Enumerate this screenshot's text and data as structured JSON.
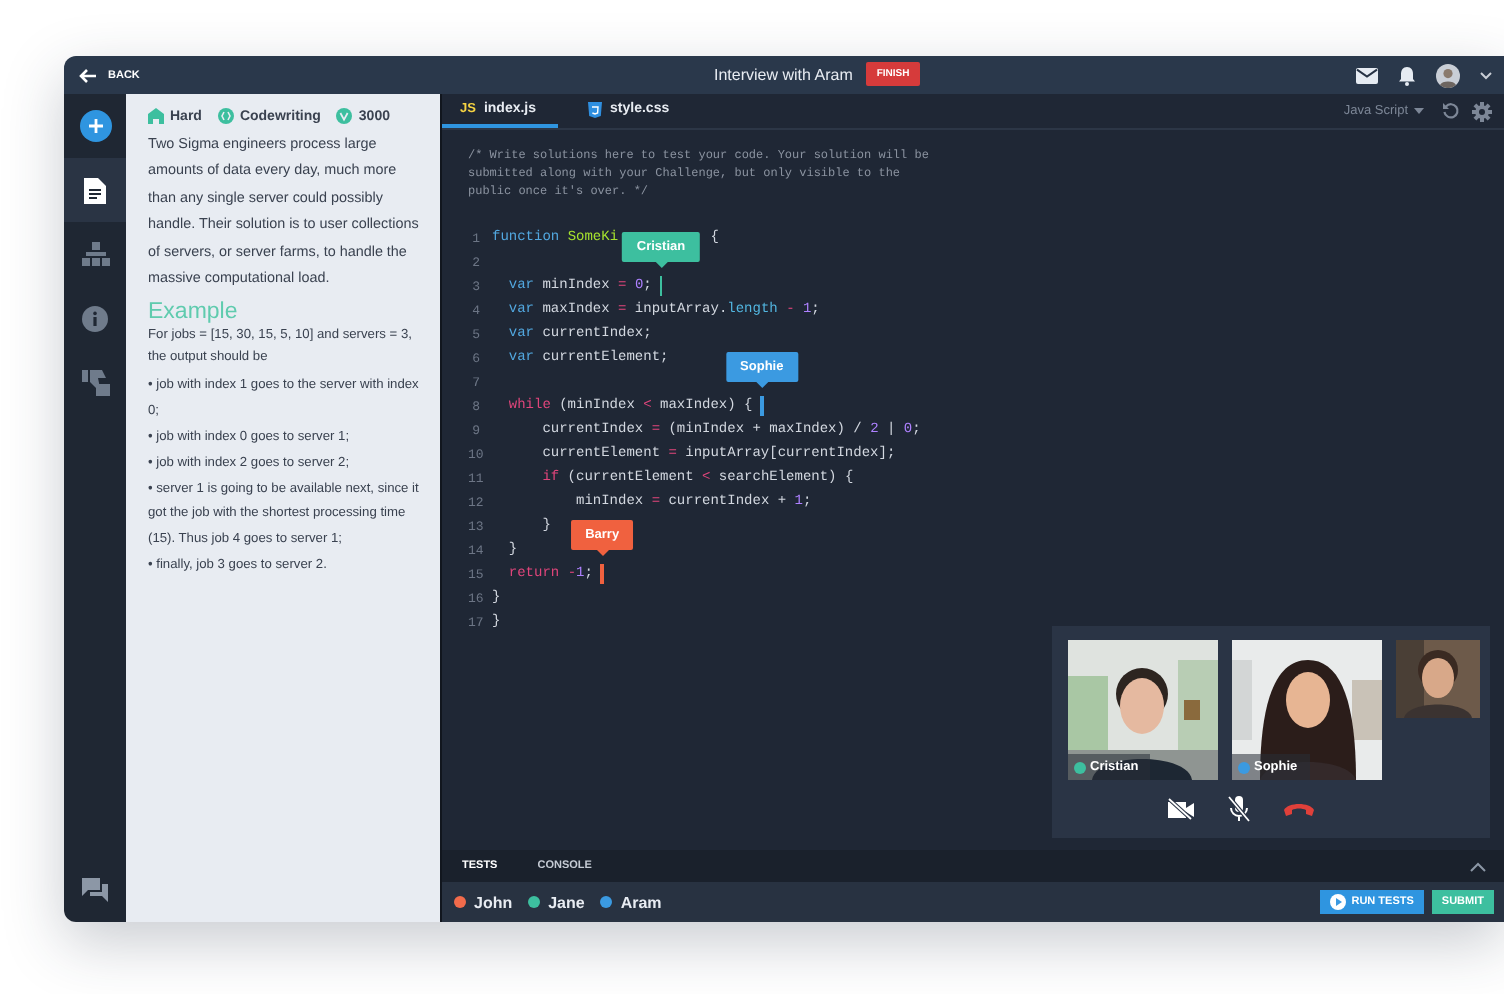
{
  "header": {
    "back": "BACK",
    "title": "Interview with Aram",
    "finish": "FINISH"
  },
  "rail": [
    {
      "kind": "document",
      "selected": true
    },
    {
      "kind": "tree",
      "selected": false
    },
    {
      "kind": "info",
      "selected": false
    },
    {
      "kind": "thumbs",
      "selected": false
    }
  ],
  "task": {
    "tags": [
      {
        "kind": "difficulty",
        "label": "Hard"
      },
      {
        "kind": "type",
        "label": "Codewriting"
      },
      {
        "kind": "points",
        "label": "3000"
      }
    ],
    "description": "Two Sigma engineers process large amounts of data every day, much more than any single server could possibly handle. Their solution is to user collections of servers, or server farms, to handle the massive computational load.",
    "example_title": "Example",
    "example_intro": "For jobs = [15, 30, 15, 5, 10] and servers = 3, the output should be",
    "bullets": [
      "• job with index 1 goes to the server with index 0;",
      "• job with index 0 goes to server 1;",
      "• job with index 2 goes to server 2;",
      "• server 1 is going to be available next, since it got the job with the shortest processing time (15). Thus job 4 goes to server 1;",
      "• finally, job 3 goes to server 2."
    ]
  },
  "editor": {
    "tabs": [
      {
        "kind": "js",
        "icon_text": "JS",
        "label": "index.js",
        "selected": true
      },
      {
        "kind": "css",
        "label": "style.css",
        "selected": false
      }
    ],
    "language": "Java Script",
    "comment": [
      "/* Write solutions here to test your code. Your solution will be",
      "submitted along with your Challenge, but only visible to the",
      "public once it's over. */"
    ],
    "lines": [
      {
        "number": "1",
        "segments": [
          {
            "kind": "keyword",
            "text": "function "
          },
          {
            "kind": "func",
            "text": "SomeKi"
          }
        ],
        "after": [
          {
            "kind": "plain",
            "text": "{"
          }
        ]
      },
      {
        "number": "2"
      },
      {
        "number": "3",
        "segments": [
          {
            "kind": "keyword",
            "text": "  var"
          },
          {
            "kind": "plain",
            "text": " minIndex "
          },
          {
            "kind": "op",
            "text": "= "
          },
          {
            "kind": "number",
            "text": "0"
          },
          {
            "kind": "plain",
            "text": ";"
          }
        ],
        "cursor": {
          "name": "Cristian",
          "color": "#3dbf9f"
        }
      },
      {
        "number": "4",
        "segments": [
          {
            "kind": "keyword",
            "text": "  var"
          },
          {
            "kind": "plain",
            "text": " maxIndex "
          },
          {
            "kind": "op",
            "text": "="
          },
          {
            "kind": "plain",
            "text": " inputArray."
          },
          {
            "kind": "prop",
            "text": "length "
          },
          {
            "kind": "op",
            "text": "- "
          },
          {
            "kind": "number",
            "text": "1"
          },
          {
            "kind": "plain",
            "text": ";"
          }
        ]
      },
      {
        "number": "5",
        "segments": [
          {
            "kind": "keyword",
            "text": "  var"
          },
          {
            "kind": "plain",
            "text": " currentIndex;"
          }
        ]
      },
      {
        "number": "6",
        "segments": [
          {
            "kind": "keyword",
            "text": "  var"
          },
          {
            "kind": "plain",
            "text": " currentElement;"
          }
        ]
      },
      {
        "number": "7"
      },
      {
        "number": "8",
        "segments": [
          {
            "kind": "control",
            "text": "  while"
          },
          {
            "kind": "plain",
            "text": " (minIndex "
          },
          {
            "kind": "op",
            "text": "<"
          },
          {
            "kind": "plain",
            "text": " maxIndex) {"
          }
        ],
        "cursor": {
          "name": "Sophie",
          "color": "#3b9ae1"
        }
      },
      {
        "number": "9",
        "segments": [
          {
            "kind": "plain",
            "text": "      currentIndex "
          },
          {
            "kind": "op",
            "text": "="
          },
          {
            "kind": "plain",
            "text": " (minIndex + maxIndex) / "
          },
          {
            "kind": "number",
            "text": "2"
          },
          {
            "kind": "plain",
            "text": " | "
          },
          {
            "kind": "number",
            "text": "0"
          },
          {
            "kind": "plain",
            "text": ";"
          }
        ]
      },
      {
        "number": "10",
        "segments": [
          {
            "kind": "plain",
            "text": "      currentElement "
          },
          {
            "kind": "op",
            "text": "="
          },
          {
            "kind": "plain",
            "text": " inputArray[currentIndex];"
          }
        ]
      },
      {
        "number": "11",
        "segments": [
          {
            "kind": "control",
            "text": "      if"
          },
          {
            "kind": "plain",
            "text": " (currentElement "
          },
          {
            "kind": "op",
            "text": "<"
          },
          {
            "kind": "plain",
            "text": " searchElement) {"
          }
        ]
      },
      {
        "number": "12",
        "segments": [
          {
            "kind": "plain",
            "text": "          minIndex "
          },
          {
            "kind": "op",
            "text": "="
          },
          {
            "kind": "plain",
            "text": " currentIndex + "
          },
          {
            "kind": "number",
            "text": "1"
          },
          {
            "kind": "plain",
            "text": ";"
          }
        ]
      },
      {
        "number": "13",
        "segments": [
          {
            "kind": "plain",
            "text": "      }"
          }
        ]
      },
      {
        "number": "14",
        "segments": [
          {
            "kind": "plain",
            "text": "  }"
          }
        ]
      },
      {
        "number": "15",
        "segments": [
          {
            "kind": "control",
            "text": "  return "
          },
          {
            "kind": "op",
            "text": "-"
          },
          {
            "kind": "number",
            "text": "1"
          },
          {
            "kind": "plain",
            "text": ";"
          }
        ],
        "cursor": {
          "name": "Barry",
          "color": "#f0613f"
        }
      },
      {
        "number": "16",
        "segments": [
          {
            "kind": "plain",
            "text": "}"
          }
        ]
      },
      {
        "number": "17",
        "segments": [
          {
            "kind": "plain",
            "text": "}"
          }
        ]
      }
    ]
  },
  "video": {
    "tiles": [
      {
        "name": "Cristian",
        "color": "#3dbf9f"
      },
      {
        "name": "Sophie",
        "color": "#3b9ae1"
      }
    ]
  },
  "bottom_tabs": [
    {
      "label": "TESTS",
      "selected": true
    },
    {
      "label": "CONSOLE",
      "selected": false
    }
  ],
  "participants": [
    {
      "name": "John",
      "color": "#f26b4b"
    },
    {
      "name": "Jane",
      "color": "#3dbf9f"
    },
    {
      "name": "Aram",
      "color": "#3b9ae1"
    }
  ],
  "buttons": {
    "run": "RUN TESTS",
    "submit": "SUBMIT"
  }
}
